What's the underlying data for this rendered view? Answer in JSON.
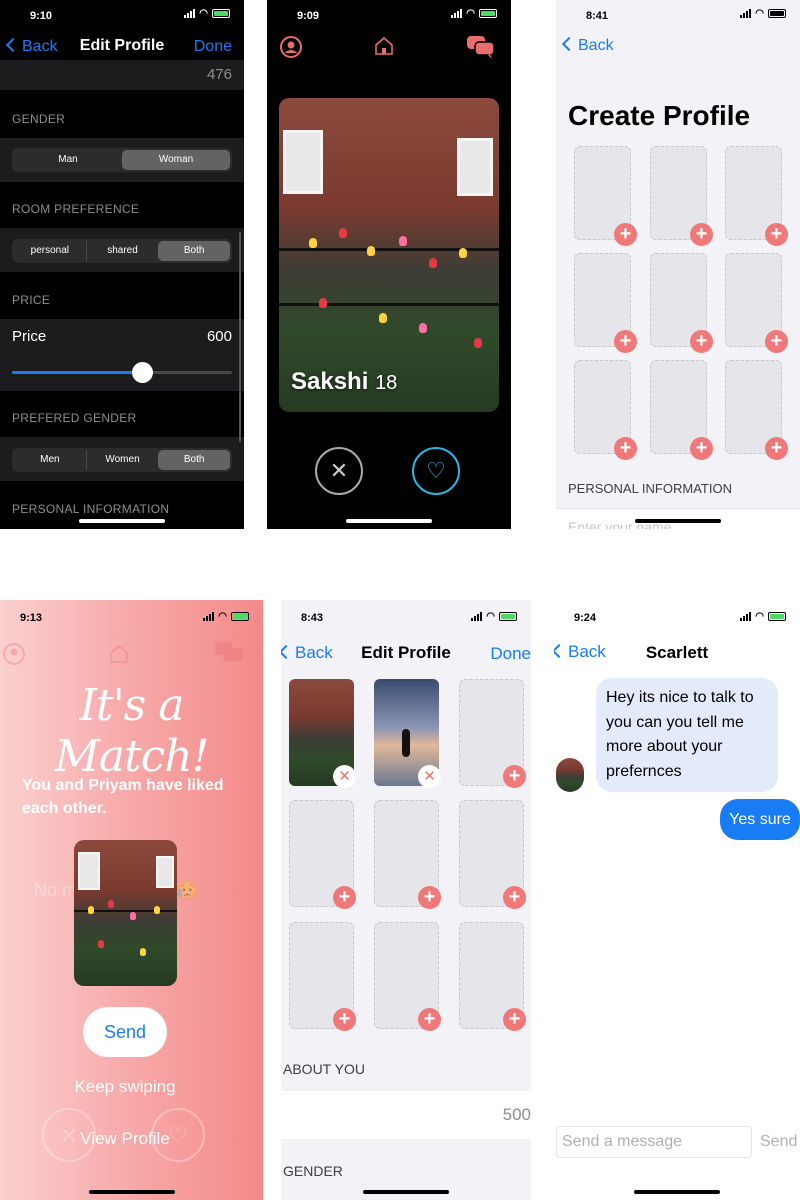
{
  "s1": {
    "time": "9:10",
    "back": "Back",
    "title": "Edit Profile",
    "done": "Done",
    "top_value": "476",
    "gender_section": "GENDER",
    "gender_options": [
      "Man",
      "Woman"
    ],
    "gender_selected": 1,
    "room_section": "ROOM PREFERENCE",
    "room_options": [
      "personal",
      "shared",
      "Both"
    ],
    "room_selected": 2,
    "price_section": "PRICE",
    "price_label": "Price",
    "price_value": "600",
    "price_fraction": 0.59,
    "pref_section": "PREFERED GENDER",
    "pref_options": [
      "Men",
      "Women",
      "Both"
    ],
    "pref_selected": 2,
    "personal_section": "PERSONAL INFORMATION"
  },
  "s2": {
    "time": "9:09",
    "name": "Sakshi",
    "age": "18",
    "icons": [
      "profile-icon",
      "home-icon",
      "chat-icon",
      "close-icon",
      "heart-icon"
    ],
    "accent": "#e86d6d"
  },
  "s3": {
    "time": "8:41",
    "back": "Back",
    "title": "Create Profile",
    "personal_section": "PERSONAL INFORMATION",
    "name_placeholder": "Enter your name"
  },
  "s4": {
    "time": "9:13",
    "match_title": "It's a Match!",
    "subtitle": "You and Priyam have liked each other.",
    "background_text": "No more profiles. 😥",
    "send": "Send",
    "keep_swiping": "Keep swiping",
    "view_profile": "View Profile"
  },
  "s5": {
    "time": "8:43",
    "back": "Back",
    "title": "Edit Profile",
    "done": "Done",
    "about_section": "ABOUT YOU",
    "about_value": "500",
    "gender_section": "GENDER"
  },
  "s6": {
    "time": "9:24",
    "back": "Back",
    "title": "Scarlett",
    "incoming": "Hey its nice to talk to you can you tell me more about your prefernces",
    "outgoing": "Yes sure",
    "input_placeholder": "Send a message",
    "send": "Send"
  }
}
